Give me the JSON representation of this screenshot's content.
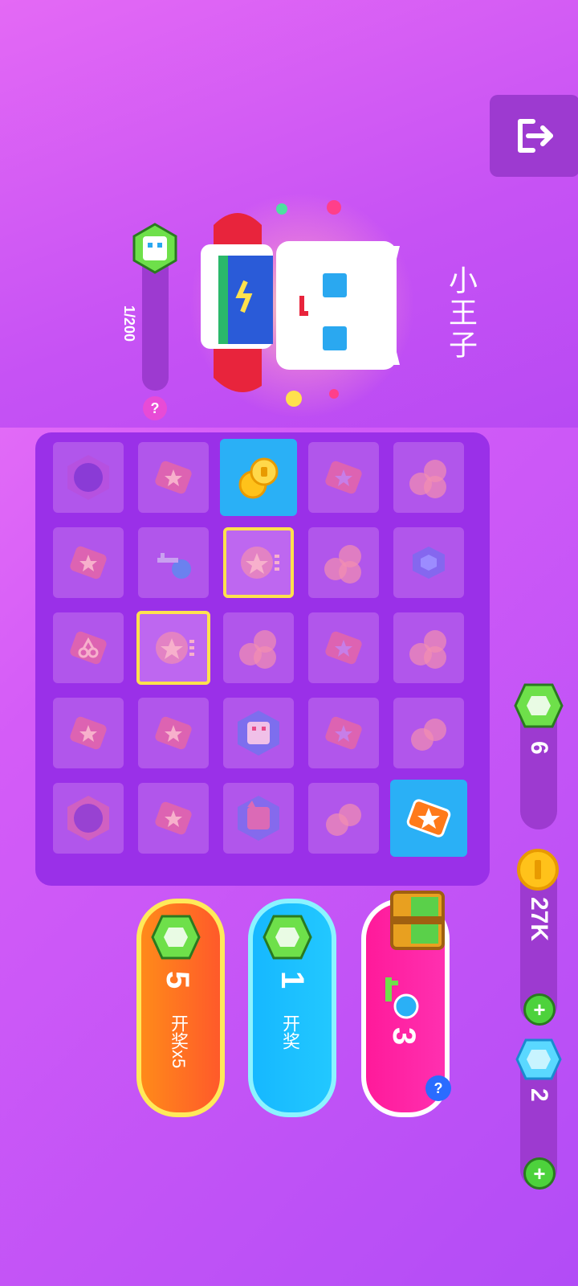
{
  "hero": {
    "name": "小王子"
  },
  "progress": {
    "text": "1/200",
    "value": 0.005,
    "help": "?"
  },
  "share": {
    "icon": "share-icon"
  },
  "board": {
    "rows": 5,
    "cols": 5,
    "cells": [
      [
        "monster",
        "ticket",
        "coins-revealed",
        "ticket",
        "coins"
      ],
      [
        "ticket",
        "key",
        "coin-card",
        "coins",
        "gem"
      ],
      [
        "cherry-ticket",
        "coin-card",
        "coins",
        "ticket",
        "coins"
      ],
      [
        "ticket",
        "ticket",
        "hero",
        "ticket",
        "coins"
      ],
      [
        "monster",
        "ticket",
        "cat",
        "coins",
        "ticket-revealed"
      ]
    ]
  },
  "actions": {
    "draw5": {
      "cost": "5",
      "label": "开奖x5"
    },
    "draw1": {
      "cost": "1",
      "label": "开奖"
    },
    "chest": {
      "keys": "3",
      "help": "?"
    }
  },
  "currencies": {
    "green_gems": "6",
    "coins": "27K",
    "diamonds": "2",
    "plus": "+"
  },
  "colors": {
    "accent_orange": "#ff6a1f",
    "accent_blue": "#1ec0ff",
    "accent_pink": "#ff1fa3",
    "board_bg": "#9a30e8",
    "panel_bg": "#9d3ad0",
    "highlight_yellow": "#ffe14d"
  }
}
